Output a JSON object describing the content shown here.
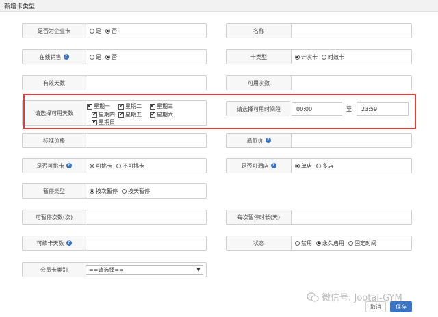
{
  "title": "新增卡类型",
  "close": "×",
  "fields": {
    "enterprise": {
      "label": "是否为企业卡",
      "options": [
        "是",
        "否"
      ],
      "selected": 1
    },
    "name": {
      "label": "名称",
      "value": ""
    },
    "online": {
      "label": "在线销售",
      "options": [
        "是",
        "否"
      ],
      "selected": 1
    },
    "cardtype": {
      "label": "卡类型",
      "options": [
        "计次卡",
        "时效卡"
      ],
      "selected": 0
    },
    "validdays": {
      "label": "有效天数",
      "value": ""
    },
    "usecount": {
      "label": "可用次数",
      "value": ""
    },
    "days": {
      "label": "请选择可用天数",
      "items": [
        "星期一",
        "星期二",
        "星期三",
        "星期四",
        "星期五",
        "星期六",
        "星期日"
      ]
    },
    "period": {
      "label": "请选择可用时间段",
      "start": "00:00",
      "sep": "至",
      "end": "23:59"
    },
    "stdprice": {
      "label": "标准价格",
      "value": ""
    },
    "minprice": {
      "label": "最低价",
      "value": ""
    },
    "pick": {
      "label": "是否可挑卡",
      "options": [
        "可挑卡",
        "不可挑卡"
      ],
      "selected": 0
    },
    "stores": {
      "label": "是否可通店",
      "options": [
        "单店",
        "多店"
      ],
      "selected": 0
    },
    "pausetype": {
      "label": "暂停类型",
      "options": [
        "按次暂停",
        "按天暂停"
      ],
      "selected": 0
    },
    "pausecount": {
      "label": "可暂停次数(次)",
      "value": ""
    },
    "pauselen": {
      "label": "每次暂停时长(天)",
      "value": ""
    },
    "renewdays": {
      "label": "可续卡天数",
      "value": ""
    },
    "status": {
      "label": "状态",
      "options": [
        "禁用",
        "永久启用",
        "固定时间"
      ],
      "selected": 1
    },
    "membertype": {
      "label": "会员卡类别",
      "selected": "==请选择=="
    }
  },
  "buttons": {
    "cancel": "取消",
    "save": "保存"
  },
  "watermark": "微信号: Jootai-GYM",
  "colors": {
    "accent": "#3b73c4",
    "highlight": "#e0403a"
  }
}
